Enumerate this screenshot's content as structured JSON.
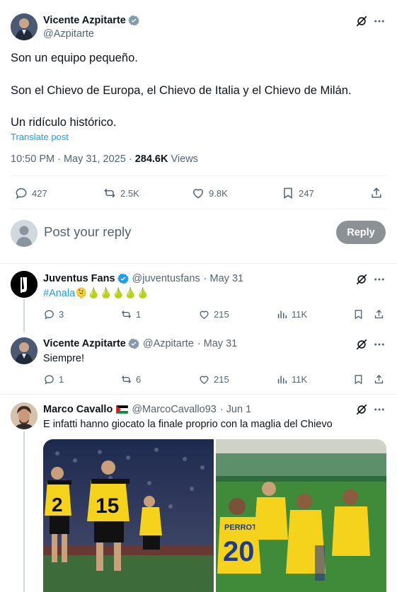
{
  "main_post": {
    "name": "Vicente Azpitarte",
    "handle": "@Azpitarte",
    "line1": "Son un equipo pequeño.",
    "line2": "Son el Chievo de Europa, el Chievo de Italia y el Chievo de Milán.",
    "line3": "Un ridículo histórico.",
    "translate": "Translate post",
    "time": "10:50 PM · May 31, 2025 · ",
    "views_count": "284.6K",
    "views_label": " Views",
    "replies": "427",
    "reposts": "2.5K",
    "likes": "9.8K",
    "bookmarks": "247"
  },
  "reply_box": {
    "placeholder": "Post your reply",
    "button": "Reply"
  },
  "replies": [
    {
      "name": "Juventus Fans",
      "handle": "@juventusfans",
      "date": "· May 31",
      "hashtag": "#Anala",
      "emoji": "🫠🍐🍐🍐🍐🍐",
      "replies": "3",
      "reposts": "1",
      "likes": "215",
      "views": "11K"
    },
    {
      "name": "Vicente Azpitarte",
      "handle": "@Azpitarte",
      "date": "· May 31",
      "text": "Siempre!",
      "replies": "1",
      "reposts": "6",
      "likes": "215",
      "views": "11K"
    },
    {
      "name": "Marco Cavallo",
      "handle": "@MarcoCavallo93",
      "date": "· Jun 1",
      "text": "E infatti hanno giocato la finale proprio con la maglia del Chievo"
    }
  ],
  "colors": {
    "link": "#1d9bf0",
    "muted": "#536471",
    "jersey_yellow": "#f5d21c",
    "reply_button": "#8c9196"
  }
}
